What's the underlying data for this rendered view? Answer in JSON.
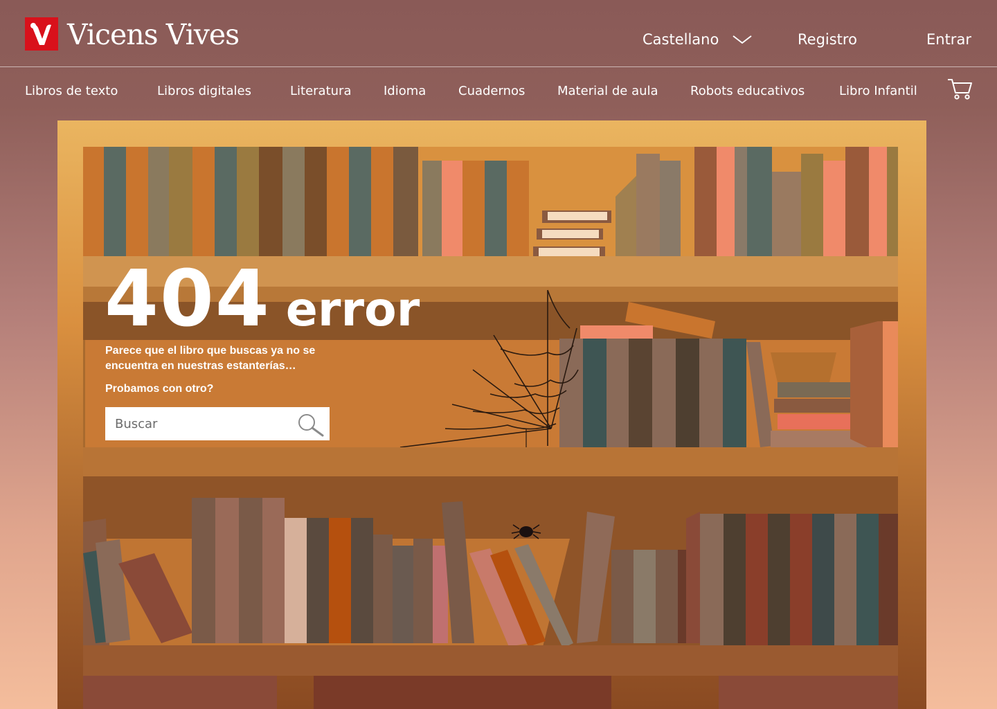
{
  "brand": {
    "name": "Vicens Vives",
    "logo_color": "#d9111b"
  },
  "header": {
    "language": "Castellano",
    "register": "Registro",
    "login": "Entrar"
  },
  "nav": {
    "items": [
      "Libros de texto",
      "Libros digitales",
      "Literatura",
      "Idioma",
      "Cuadernos",
      "Material de aula",
      "Robots educativos",
      "Libro Infantil"
    ],
    "cart_icon": "cart-icon"
  },
  "error": {
    "code": "404",
    "word": "error",
    "message": "Parece que el libro que buscas ya no se encuentra en nuestras estanterías…",
    "prompt": "Probamos con otro?"
  },
  "search": {
    "placeholder": "Buscar",
    "icon": "search-icon"
  },
  "colors": {
    "shelf_orange": "#c97a35",
    "shelf_dark": "#8a5428",
    "accent_red": "#d9111b"
  }
}
